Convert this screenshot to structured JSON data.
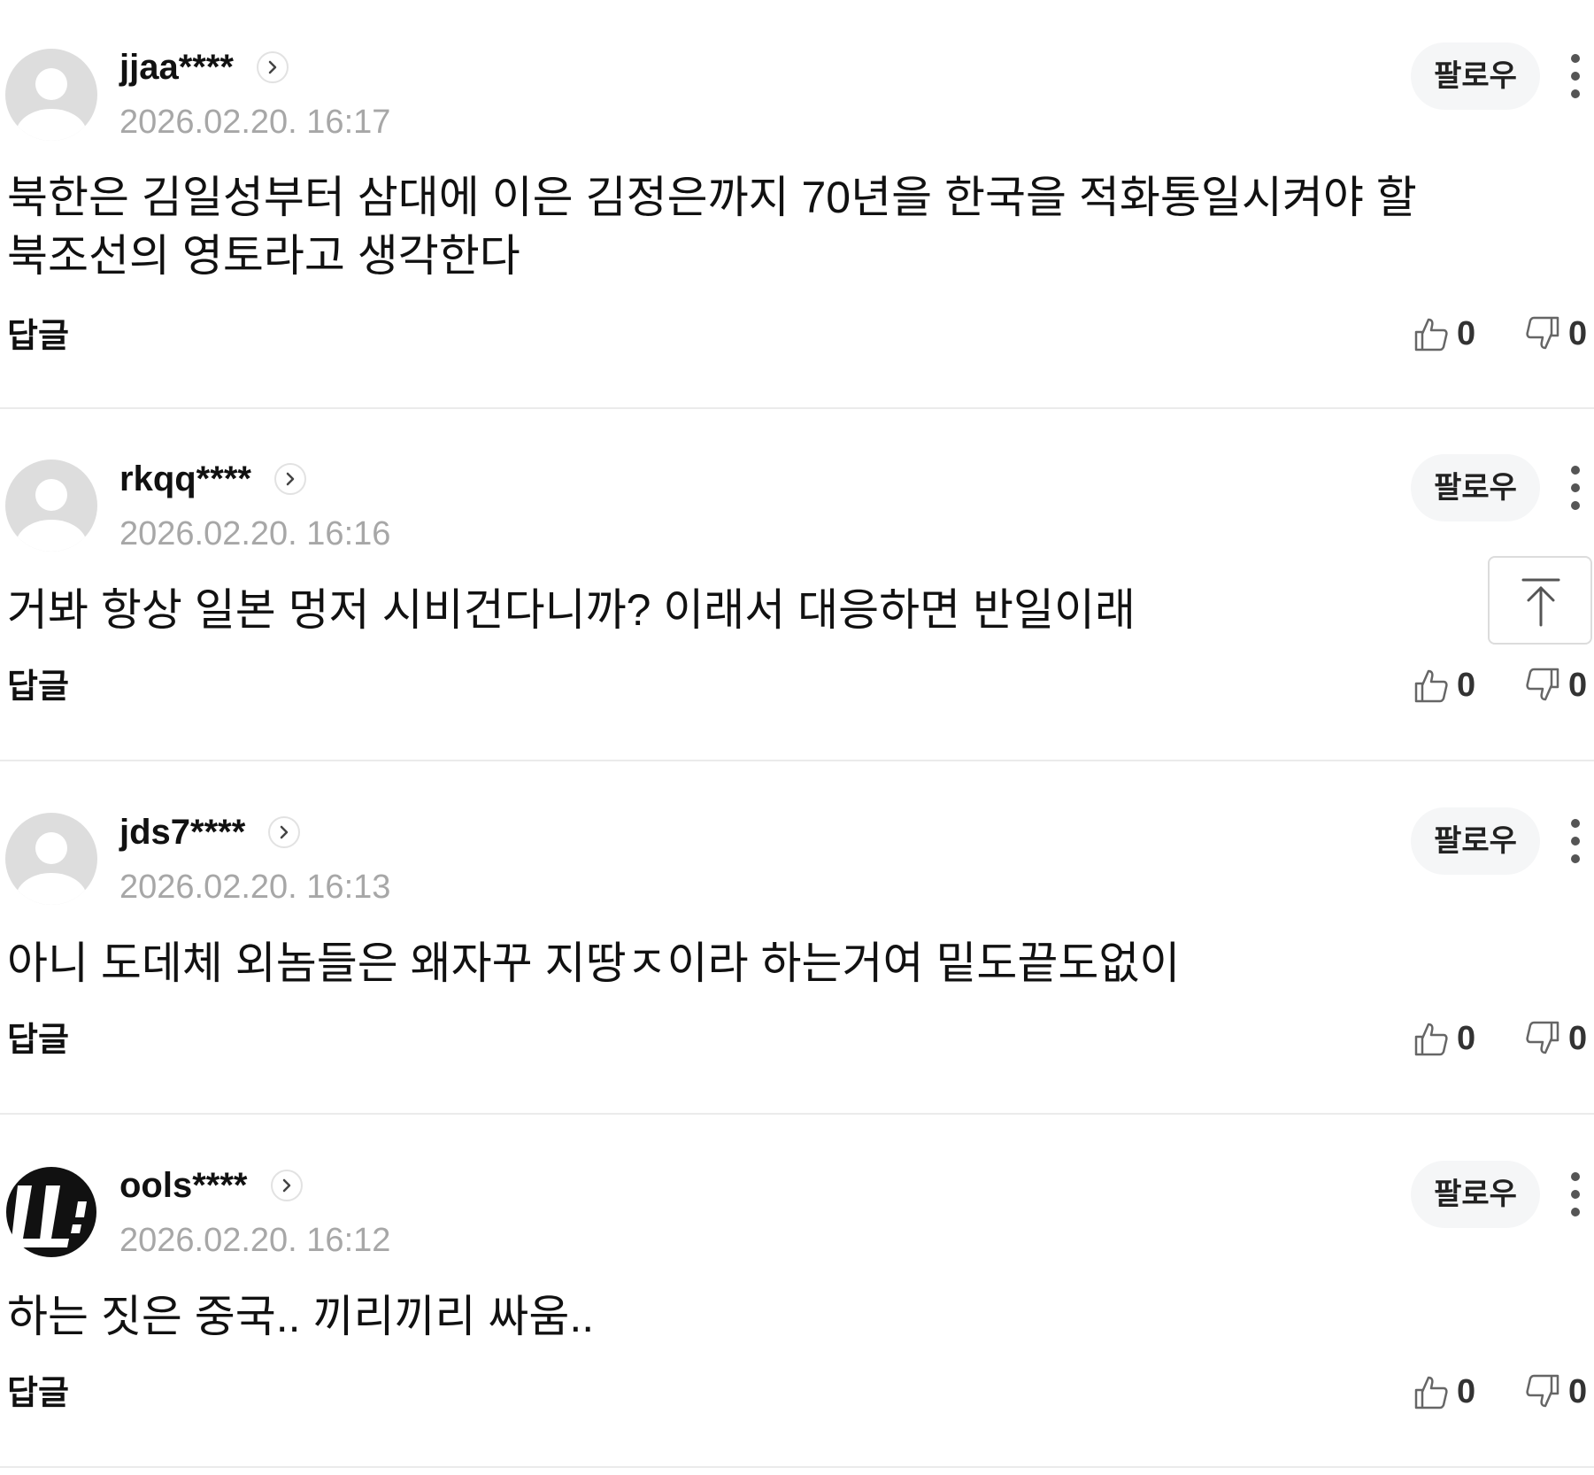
{
  "follow_label": "팔로우",
  "reply_label": "답글",
  "icons": {
    "avatar": "default-avatar-icon",
    "profile": "chevron-right-icon",
    "more": "more-vertical-icon",
    "like": "thumbs-up-icon",
    "dislike": "thumbs-down-icon",
    "scroll_top": "arrow-up-icon"
  },
  "colors": {
    "timestamp": "#a7a7a7",
    "divider": "#ebebeb",
    "follow_bg": "#f5f6f7"
  },
  "comments": [
    {
      "username": "jjaa****",
      "timestamp": "2026.02.20. 16:17",
      "text": "북한은 김일성부터 삼대에 이은 김정은까지 70년을 한국을 적화통일시켜야 할 북조선의 영토라고 생각한다",
      "likes": "0",
      "dislikes": "0"
    },
    {
      "username": "rkqq****",
      "timestamp": "2026.02.20. 16:16",
      "text": "거봐 항상 일본 멍저 시비건다니까? 이래서 대응하면 반일이래",
      "likes": "0",
      "dislikes": "0"
    },
    {
      "username": "jds7****",
      "timestamp": "2026.02.20. 16:13",
      "text": "아니 도데체 외놈들은 왜자꾸 지땅ㅈ이라 하는거여 밑도끝도없이",
      "likes": "0",
      "dislikes": "0"
    },
    {
      "username": "ools****",
      "timestamp": "2026.02.20. 16:12",
      "text": "하는 짓은 중국.. 끼리끼리 싸움..",
      "likes": "0",
      "dislikes": "0"
    }
  ]
}
